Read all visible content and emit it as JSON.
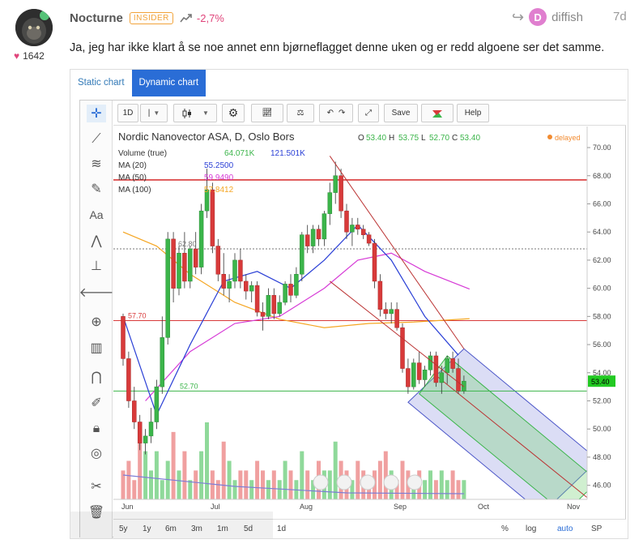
{
  "post": {
    "username": "Nocturne",
    "badge": "INSIDER",
    "performance": "-2,7%",
    "likes": "1642",
    "reply_to": "diffish",
    "reply_initial": "D",
    "age": "7d",
    "message": "Ja, jeg har ikke klart å se noe annet enn bjørneflagget denne uken og er redd algoene ser det samme."
  },
  "chart_widget": {
    "tabs": [
      "Static chart",
      "Dynamic chart"
    ],
    "active_tab": "Dynamic chart",
    "toolbar": {
      "interval": "1D",
      "save": "Save",
      "help": "Help"
    },
    "bottom_ranges": [
      "5y",
      "1y",
      "6m",
      "3m",
      "1m",
      "5d",
      "1d"
    ],
    "bottom_right": [
      "%",
      "log",
      "auto",
      "SP"
    ],
    "bottom_active": "auto",
    "colors": {
      "up": "#3bb54a",
      "down": "#d83a3a",
      "accent": "#2a6dd6"
    }
  },
  "chart_data": {
    "type": "candlestick",
    "title": "Nordic Nanovector ASA, D, Oslo Bors",
    "ohlc": {
      "O": "53.40",
      "H": "53.75",
      "L": "52.70",
      "C": "53.40"
    },
    "status": "delayed",
    "last_price": "53.40",
    "y_ticks": [
      46,
      48,
      50,
      52,
      54,
      56,
      58,
      60,
      62,
      64,
      66,
      68,
      70
    ],
    "y_tick_labels": [
      "46.00",
      "48.00",
      "50.00",
      "52.00",
      "54.00",
      "56.00",
      "58.00",
      "60.00",
      "62.00",
      "64.00",
      "66.00",
      "68.00",
      "70.00"
    ],
    "ylim": [
      45,
      71.5
    ],
    "x_labels": [
      "Jun",
      "Jul",
      "Aug",
      "Sep",
      "Oct",
      "Nov"
    ],
    "indicators": [
      {
        "label": "Volume (true)",
        "values": [
          "64.071K",
          "121.501K"
        ],
        "colors": [
          "#3bb54a",
          "#2a3fd6"
        ]
      },
      {
        "label": "MA (20)",
        "values": [
          "55.2500"
        ],
        "colors": [
          "#2a3fd6"
        ]
      },
      {
        "label": "MA (50)",
        "values": [
          "59.9490"
        ],
        "colors": [
          "#d63ad6"
        ]
      },
      {
        "label": "MA (100)",
        "values": [
          "57.8412"
        ],
        "colors": [
          "#f5a623"
        ]
      }
    ],
    "hlines": [
      {
        "y": 67.7,
        "color": "#d83a3a",
        "label": ""
      },
      {
        "y": 57.7,
        "color": "#d83a3a",
        "label": "57.70"
      },
      {
        "y": 52.7,
        "color": "#3bb54a",
        "label": "52.70"
      },
      {
        "y": 62.8,
        "color": "#777",
        "label": "62.80"
      }
    ],
    "candles": [
      [
        58.0,
        58.2,
        54.5,
        55.0
      ],
      [
        55.0,
        55.5,
        51.5,
        52.0
      ],
      [
        52.0,
        53.0,
        50.0,
        50.5
      ],
      [
        50.5,
        51.0,
        48.5,
        49.0
      ],
      [
        49.0,
        50.0,
        48.2,
        49.5
      ],
      [
        49.5,
        51.5,
        49.0,
        50.5
      ],
      [
        50.5,
        53.5,
        50.0,
        53.0
      ],
      [
        53.0,
        58.0,
        52.5,
        56.5
      ],
      [
        56.5,
        64.0,
        56.0,
        63.5
      ],
      [
        63.5,
        64.0,
        59.0,
        60.0
      ],
      [
        60.0,
        63.0,
        59.5,
        62.5
      ],
      [
        62.5,
        64.0,
        60.0,
        60.5
      ],
      [
        60.5,
        63.0,
        60.0,
        62.8
      ],
      [
        62.8,
        64.0,
        61.0,
        61.5
      ],
      [
        61.5,
        66.0,
        61.0,
        65.5
      ],
      [
        65.5,
        68.5,
        65.0,
        67.0
      ],
      [
        67.0,
        67.5,
        62.5,
        63.0
      ],
      [
        63.0,
        63.5,
        60.5,
        61.0
      ],
      [
        61.0,
        62.5,
        59.5,
        60.0
      ],
      [
        60.0,
        61.0,
        59.0,
        60.5
      ],
      [
        60.5,
        62.5,
        60.0,
        62.0
      ],
      [
        62.0,
        62.8,
        60.0,
        60.5
      ],
      [
        60.5,
        61.0,
        59.2,
        59.8
      ],
      [
        59.8,
        60.5,
        59.0,
        60.2
      ],
      [
        60.2,
        60.5,
        58.0,
        58.3
      ],
      [
        58.3,
        59.0,
        57.0,
        58.0
      ],
      [
        58.0,
        60.0,
        57.8,
        59.5
      ],
      [
        59.5,
        60.0,
        57.8,
        58.2
      ],
      [
        58.2,
        59.5,
        58.0,
        59.0
      ],
      [
        59.0,
        60.5,
        58.8,
        60.3
      ],
      [
        60.3,
        61.0,
        59.0,
        59.5
      ],
      [
        59.5,
        61.5,
        59.3,
        61.0
      ],
      [
        61.0,
        64.0,
        60.5,
        63.8
      ],
      [
        63.8,
        64.5,
        62.5,
        63.0
      ],
      [
        63.0,
        64.5,
        62.5,
        64.2
      ],
      [
        64.2,
        64.5,
        63.0,
        63.5
      ],
      [
        63.5,
        65.5,
        63.0,
        65.3
      ],
      [
        65.3,
        67.5,
        64.5,
        66.8
      ],
      [
        66.8,
        69.0,
        66.0,
        68.0
      ],
      [
        68.0,
        68.5,
        65.0,
        65.5
      ],
      [
        65.5,
        66.0,
        63.5,
        64.0
      ],
      [
        64.0,
        65.0,
        63.0,
        64.5
      ],
      [
        64.5,
        65.0,
        63.8,
        64.2
      ],
      [
        64.2,
        64.5,
        63.5,
        63.8
      ],
      [
        63.8,
        64.0,
        63.0,
        63.2
      ],
      [
        63.2,
        63.5,
        60.0,
        60.5
      ],
      [
        60.5,
        61.0,
        58.0,
        58.5
      ],
      [
        58.5,
        59.0,
        57.8,
        58.2
      ],
      [
        58.2,
        59.0,
        57.5,
        58.5
      ],
      [
        58.5,
        59.0,
        57.0,
        57.2
      ],
      [
        57.2,
        57.5,
        54.0,
        54.3
      ],
      [
        54.3,
        55.0,
        52.5,
        53.0
      ],
      [
        53.0,
        55.0,
        52.8,
        54.7
      ],
      [
        54.7,
        55.5,
        53.2,
        53.5
      ],
      [
        53.5,
        54.5,
        53.0,
        54.2
      ],
      [
        54.2,
        55.5,
        53.8,
        55.2
      ],
      [
        55.2,
        55.5,
        53.0,
        53.3
      ],
      [
        53.3,
        54.5,
        52.5,
        54.0
      ],
      [
        54.0,
        55.2,
        53.2,
        55.0
      ],
      [
        55.0,
        55.5,
        54.0,
        54.3
      ],
      [
        54.3,
        55.0,
        52.5,
        52.7
      ],
      [
        52.7,
        53.8,
        52.5,
        53.4
      ]
    ],
    "volume": [
      3,
      4,
      2,
      6,
      5,
      3,
      5,
      2,
      4,
      7,
      3,
      5,
      2,
      3,
      5,
      8,
      3,
      2,
      6,
      4,
      2,
      3,
      3,
      2,
      4,
      3,
      2,
      3,
      2,
      4,
      3,
      2,
      5,
      3,
      2,
      4,
      3,
      3,
      6,
      4,
      3,
      2,
      4,
      3,
      2,
      3,
      4,
      5,
      3,
      2,
      4,
      3,
      2,
      3,
      2,
      3,
      2,
      3,
      2,
      3,
      2,
      2
    ],
    "ma20": [
      [
        0,
        58.0
      ],
      [
        6,
        51.0
      ],
      [
        12,
        56.0
      ],
      [
        18,
        60.5
      ],
      [
        24,
        61.2
      ],
      [
        30,
        60.0
      ],
      [
        36,
        62.0
      ],
      [
        42,
        64.5
      ],
      [
        48,
        62.0
      ],
      [
        54,
        58.0
      ],
      [
        60,
        55.25
      ]
    ],
    "ma50": [
      [
        4,
        52.0
      ],
      [
        12,
        55.5
      ],
      [
        20,
        57.5
      ],
      [
        28,
        58.0
      ],
      [
        36,
        60.0
      ],
      [
        42,
        62.0
      ],
      [
        48,
        62.5
      ],
      [
        54,
        61.2
      ],
      [
        62,
        59.949
      ]
    ],
    "ma100": [
      [
        0,
        64.0
      ],
      [
        6,
        63.0
      ],
      [
        12,
        61.0
      ],
      [
        20,
        59.0
      ],
      [
        28,
        57.8
      ],
      [
        36,
        57.2
      ],
      [
        44,
        57.5
      ],
      [
        52,
        57.6
      ],
      [
        62,
        57.8412
      ]
    ],
    "trendlines": [
      [
        37,
        69.4,
        61,
        55.7
      ],
      [
        37,
        60.5,
        61,
        53.0
      ]
    ],
    "channel": {
      "upper": [
        [
          61,
          55.7
        ],
        [
          85,
          47.8
        ]
      ],
      "lower": [
        [
          51,
          51.9
        ],
        [
          75,
          44.0
        ]
      ],
      "mid": [
        [
          56,
          53.8
        ],
        [
          85,
          44.5
        ]
      ]
    }
  }
}
